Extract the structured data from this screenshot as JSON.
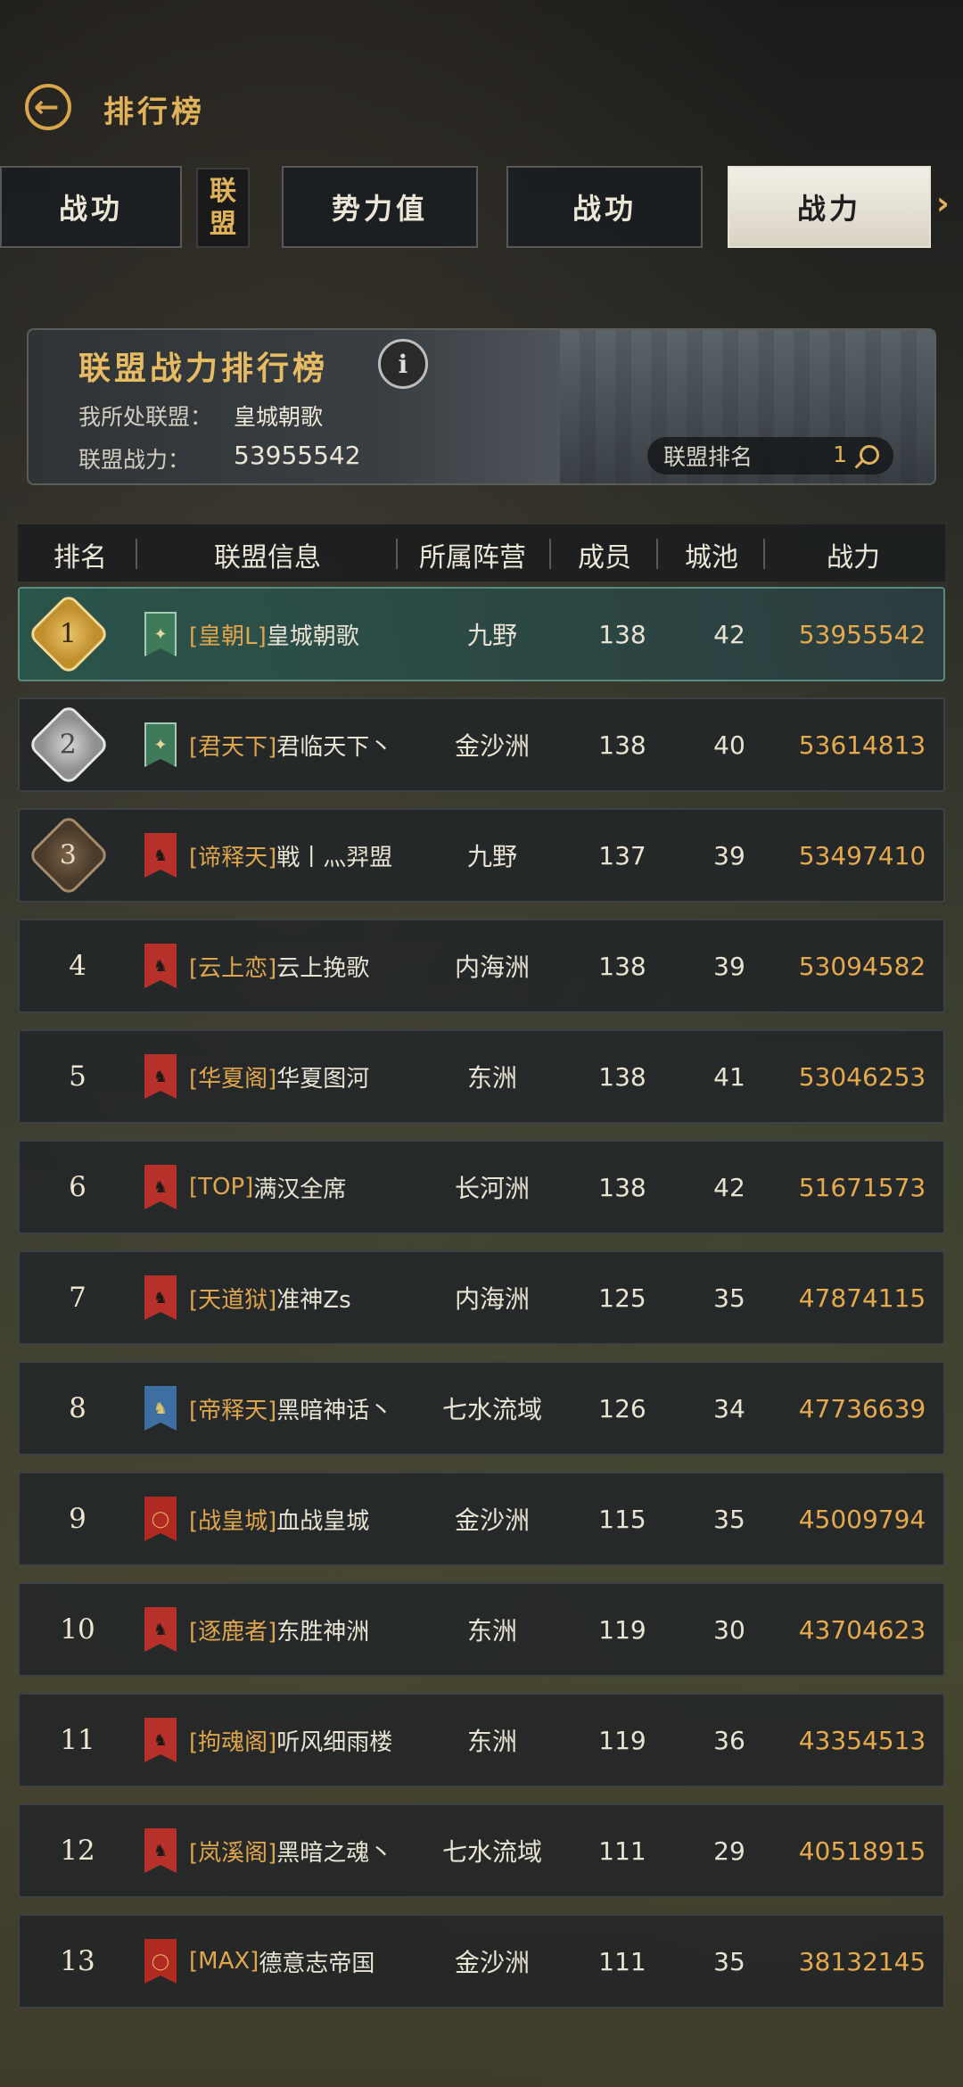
{
  "header": {
    "title": "排行榜"
  },
  "tabs": [
    {
      "label": "战功"
    },
    {
      "label": "势力值"
    },
    {
      "label": "战功"
    },
    {
      "label": "战力",
      "active": true
    }
  ],
  "alliance_tab": {
    "line1": "联",
    "line2": "盟"
  },
  "banner": {
    "title": "联盟战力排行榜",
    "my_alliance_label": "我所处联盟：",
    "my_alliance_value": "皇城朝歌",
    "power_label": "联盟战力：",
    "power_value": "53955542",
    "rank_label": "联盟排名",
    "rank_value": "1"
  },
  "columns": {
    "rank": "排名",
    "info": "联盟信息",
    "camp": "所属阵营",
    "members": "成员",
    "cities": "城池",
    "power": "战力"
  },
  "rows": [
    {
      "rank": "1",
      "tag": "[皇朝L]",
      "name": "皇城朝歌",
      "camp": "九野",
      "members": "138",
      "cities": "42",
      "power": "53955542"
    },
    {
      "rank": "2",
      "tag": "[君天下]",
      "name": "君临天下丶",
      "camp": "金沙洲",
      "members": "138",
      "cities": "40",
      "power": "53614813"
    },
    {
      "rank": "3",
      "tag": "[谛释天]",
      "name": "戦丨灬羿盟",
      "camp": "九野",
      "members": "137",
      "cities": "39",
      "power": "53497410"
    },
    {
      "rank": "4",
      "tag": "[云上恋]",
      "name": "云上挽歌",
      "camp": "内海洲",
      "members": "138",
      "cities": "39",
      "power": "53094582"
    },
    {
      "rank": "5",
      "tag": "[华夏阁]",
      "name": "华夏图河",
      "camp": "东洲",
      "members": "138",
      "cities": "41",
      "power": "53046253"
    },
    {
      "rank": "6",
      "tag": "[TOP]",
      "name": "满汉全席",
      "camp": "长河洲",
      "members": "138",
      "cities": "42",
      "power": "51671573"
    },
    {
      "rank": "7",
      "tag": "[天道狱]",
      "name": "准神Zs",
      "camp": "内海洲",
      "members": "125",
      "cities": "35",
      "power": "47874115"
    },
    {
      "rank": "8",
      "tag": "[帝释天]",
      "name": "黑暗神话丶",
      "camp": "七水流域",
      "members": "126",
      "cities": "34",
      "power": "47736639"
    },
    {
      "rank": "9",
      "tag": "[战皇城]",
      "name": "血战皇城",
      "camp": "金沙洲",
      "members": "115",
      "cities": "35",
      "power": "45009794"
    },
    {
      "rank": "10",
      "tag": "[逐鹿者]",
      "name": "东胜神洲",
      "camp": "东洲",
      "members": "119",
      "cities": "30",
      "power": "43704623"
    },
    {
      "rank": "11",
      "tag": "[拘魂阁]",
      "name": "听风细雨楼",
      "camp": "东洲",
      "members": "119",
      "cities": "36",
      "power": "43354513"
    },
    {
      "rank": "12",
      "tag": "[岚溪阁]",
      "name": "黑暗之魂丶",
      "camp": "七水流域",
      "members": "111",
      "cities": "29",
      "power": "40518915"
    },
    {
      "rank": "13",
      "tag": "[MAX]",
      "name": "德意志帝国",
      "camp": "金沙洲",
      "members": "111",
      "cities": "35",
      "power": "38132145"
    }
  ],
  "colors": {
    "gold": "#e0b25a",
    "power": "#e6a94c",
    "highlight_row": "#2e5a52"
  }
}
